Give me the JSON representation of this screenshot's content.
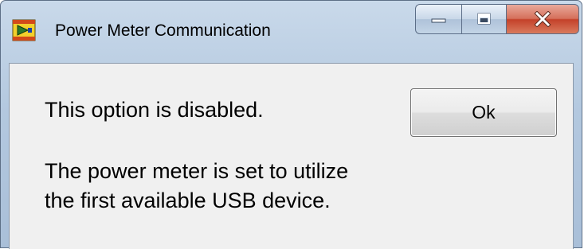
{
  "window": {
    "title": "Power Meter Communication"
  },
  "message": {
    "line1": "This option is disabled.",
    "line2": "The power meter is set to utilize",
    "line3": "the first available USB device."
  },
  "buttons": {
    "ok_label": "Ok"
  },
  "icons": {
    "app": "labview-app-icon",
    "minimize": "minimize-icon",
    "maximize": "maximize-icon",
    "close": "close-icon"
  },
  "colors": {
    "titlebar": "#b9cde3",
    "close_button": "#c9452c",
    "client_background": "#f0f0f0"
  }
}
